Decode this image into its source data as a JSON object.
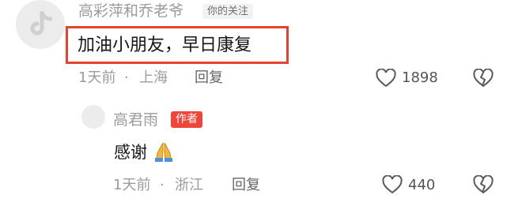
{
  "comment": {
    "username": "高彩萍和乔老爷",
    "follow_tag": "你的关注",
    "text": "加油小朋友，早日康复",
    "time": "1天前",
    "separator": "·",
    "location": "上海",
    "reply_label": "回复",
    "like_count": "1898"
  },
  "reply": {
    "username": "高君雨",
    "author_badge": "作者",
    "text": "感谢",
    "emoji": "folded-hands-icon",
    "time": "1天前",
    "separator": "·",
    "location": "浙江",
    "reply_label": "回复",
    "like_count": "440"
  },
  "colors": {
    "highlight_border": "#e8412f",
    "author_badge_bg": "#f0463a",
    "muted_text": "#9b9b9b"
  }
}
